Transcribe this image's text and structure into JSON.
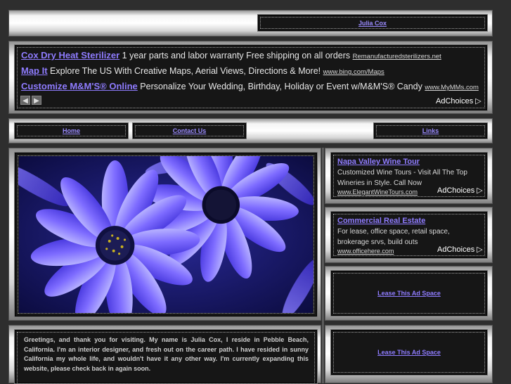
{
  "header": {
    "site_name": "Julia Cox"
  },
  "top_ads": [
    {
      "title": "Cox Dry Heat Sterilizer",
      "text": "1 year parts and labor warranty Free shipping on all orders",
      "url": "Remanufacturedsterilizers.net"
    },
    {
      "title": "Map It",
      "text": "Explore The US With Creative Maps, Aerial Views, Directions & More!",
      "url": "www.bing.com/Maps"
    },
    {
      "title": "Customize M&M'S® Online",
      "text": "Personalize Your Wedding, Birthday, Holiday or Event w/M&M'S® Candy",
      "url": "www.MyMMs.com"
    }
  ],
  "ad_controls": {
    "prev_label": "◀",
    "next_label": "▶",
    "adchoices_label": "AdChoices ▷"
  },
  "nav": {
    "home": "Home",
    "contact": "Contact Us",
    "links": "Links"
  },
  "side_ads": [
    {
      "title": "Napa Valley Wine Tour",
      "text": "Customized Wine Tours - Visit All The Top Wineries in Style. Call Now",
      "url": "www.ElegantWineTours.com"
    },
    {
      "title": "Commercial Real Estate",
      "text": "For lease, office space, retail space, brokerage srvs, build outs",
      "url": "www.officehere.com"
    }
  ],
  "lease_ads": [
    "Lease This Ad Space",
    "Lease This Ad Space"
  ],
  "bio": "Greetings, and thank you for visiting. My name is Julia Cox, I reside in Pebble Beach, California. I'm an interior designer, and fresh out on the career path. I have resided in sunny California my whole life, and wouldn't have it any other way. I'm currently expanding this website, please check back in again soon.",
  "colors": {
    "link": "#8f7cff",
    "background": "#2e2e2e",
    "panel": "#161616"
  }
}
